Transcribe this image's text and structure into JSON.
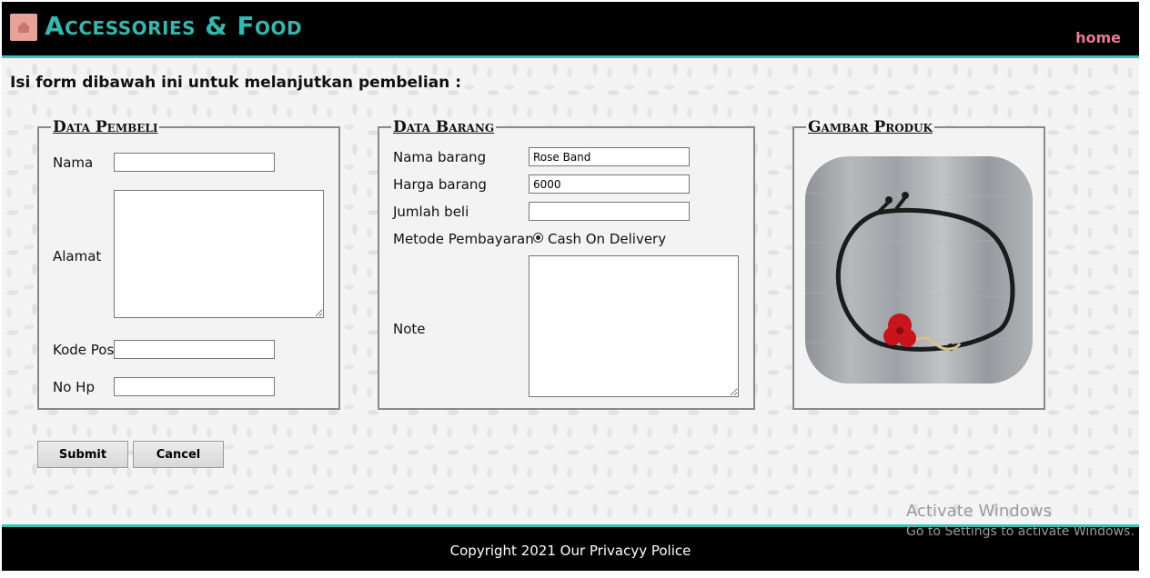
{
  "header": {
    "title": "Accessories & Food",
    "home_link": "home",
    "brand_color": "#36b6ad",
    "link_color": "#e87a9a"
  },
  "form": {
    "instruction": "Isi form dibawah ini untuk melanjutkan pembelian :",
    "buyer": {
      "legend": "Data Pembeli",
      "nama_label": "Nama",
      "nama_value": "",
      "alamat_label": "Alamat",
      "alamat_value": "",
      "kodepos_label": "Kode Pos",
      "kodepos_value": "",
      "nohp_label": "No Hp",
      "nohp_value": ""
    },
    "item": {
      "legend": "Data Barang",
      "nama_label": "Nama barang",
      "nama_value": "Rose Band",
      "harga_label": "Harga barang",
      "harga_value": "6000",
      "jumlah_label": "Jumlah beli",
      "jumlah_value": "",
      "metode_label": "Metode Pembayaran",
      "metode_option": "Cash On Delivery",
      "note_label": "Note",
      "note_value": ""
    },
    "image": {
      "legend": "Gambar Produk"
    },
    "submit_label": "Submit",
    "cancel_label": "Cancel"
  },
  "footer": {
    "copyright": "Copyright 2021 Our Privacyy Police"
  },
  "watermark": {
    "line1": "Activate Windows",
    "line2": "Go to Settings to activate Windows."
  },
  "colors": {
    "accent": "#3cc1b8",
    "header_bg": "#000000"
  }
}
